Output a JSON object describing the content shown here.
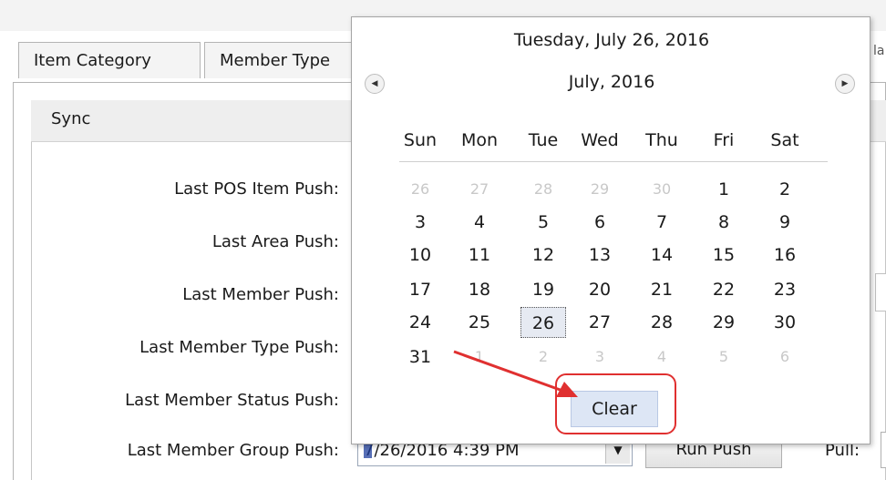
{
  "tabs": [
    "Item Category",
    "Member Type"
  ],
  "sync": {
    "title": "Sync",
    "fields": [
      {
        "label": "Last POS Item Push:"
      },
      {
        "label": "Last Area Push:"
      },
      {
        "label": "Last Member Push:"
      },
      {
        "label": "Last Member Type Push:"
      },
      {
        "label": "Last Member Status Push:"
      },
      {
        "label": "Last Member Group Push:"
      }
    ],
    "date_value": "7/26/2016 4:39 PM",
    "run_push_label": "Run Push",
    "pull_label": "Pull:"
  },
  "calendar": {
    "today_text": "Tuesday, July 26, 2016",
    "month_text": "July, 2016",
    "weekdays": [
      "Sun",
      "Mon",
      "Tue",
      "Wed",
      "Thu",
      "Fri",
      "Sat"
    ],
    "weeks": [
      [
        "26",
        "27",
        "28",
        "29",
        "30",
        "1",
        "2"
      ],
      [
        "3",
        "4",
        "5",
        "6",
        "7",
        "8",
        "9"
      ],
      [
        "10",
        "11",
        "12",
        "13",
        "14",
        "15",
        "16"
      ],
      [
        "17",
        "18",
        "19",
        "20",
        "21",
        "22",
        "23"
      ],
      [
        "24",
        "25",
        "26",
        "27",
        "28",
        "29",
        "30"
      ],
      [
        "31",
        "1",
        "2",
        "3",
        "4",
        "5",
        "6"
      ]
    ],
    "selected_day": "26",
    "clear_label": "Clear"
  },
  "colors": {
    "annotation": "#e03030",
    "clear_button": "#dde6f5",
    "selection": "#e6eaf2"
  },
  "icons": {
    "prev": "chevron-left-icon",
    "next": "chevron-right-icon",
    "dropdown": "dropdown-arrow-icon"
  }
}
